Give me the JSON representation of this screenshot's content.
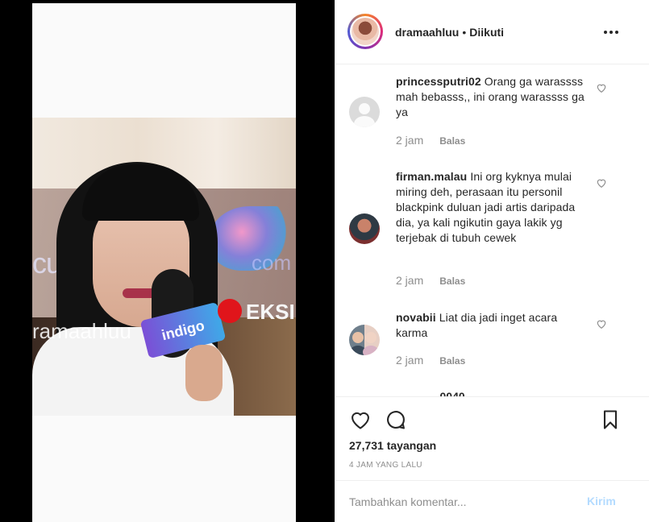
{
  "video": {
    "watermark_left": "cumicumi",
    "watermark_right": "com",
    "watermark_user": "ramaahluu",
    "mic_label": "indigo",
    "eks_label": "EKSI"
  },
  "header": {
    "username": "dramaahluu",
    "separator": "•",
    "follow_label": "Diikuti"
  },
  "comments": [
    {
      "username": "princessputri02",
      "text": "Orang ga warassss mah bebasss,, ini orang warassss ga ya",
      "time": "2 jam",
      "reply_label": "Balas",
      "avatar_icon": "default-avatar-icon"
    },
    {
      "username": "firman.malau",
      "text": "Ini org kyknya mulai miring deh, perasaan itu personil blackpink duluan jadi artis daripada dia, ya kali ngikutin gaya lakik yg terjebak di tubuh cewek",
      "time": "2 jam",
      "reply_label": "Balas",
      "avatar_icon": "user-photo-icon"
    },
    {
      "username": "novabii",
      "text": "Liat dia jadi inget acara karma",
      "time": "2 jam",
      "reply_label": "Balas",
      "avatar_icon": "user-photo-icon"
    }
  ],
  "partial_comment": "__ ___ _0040 _",
  "actions": {
    "like_icon": "heart-icon",
    "comment_icon": "comment-icon",
    "save_icon": "bookmark-icon"
  },
  "stats": {
    "views": "27,731 tayangan",
    "timestamp": "4 JAM YANG LALU"
  },
  "add_comment": {
    "placeholder": "Tambahkan komentar...",
    "post_label": "Kirim"
  },
  "colors": {
    "text_primary": "#262626",
    "text_secondary": "#8e8e8e",
    "divider": "#efefef",
    "post_disabled": "#b3dbff"
  }
}
